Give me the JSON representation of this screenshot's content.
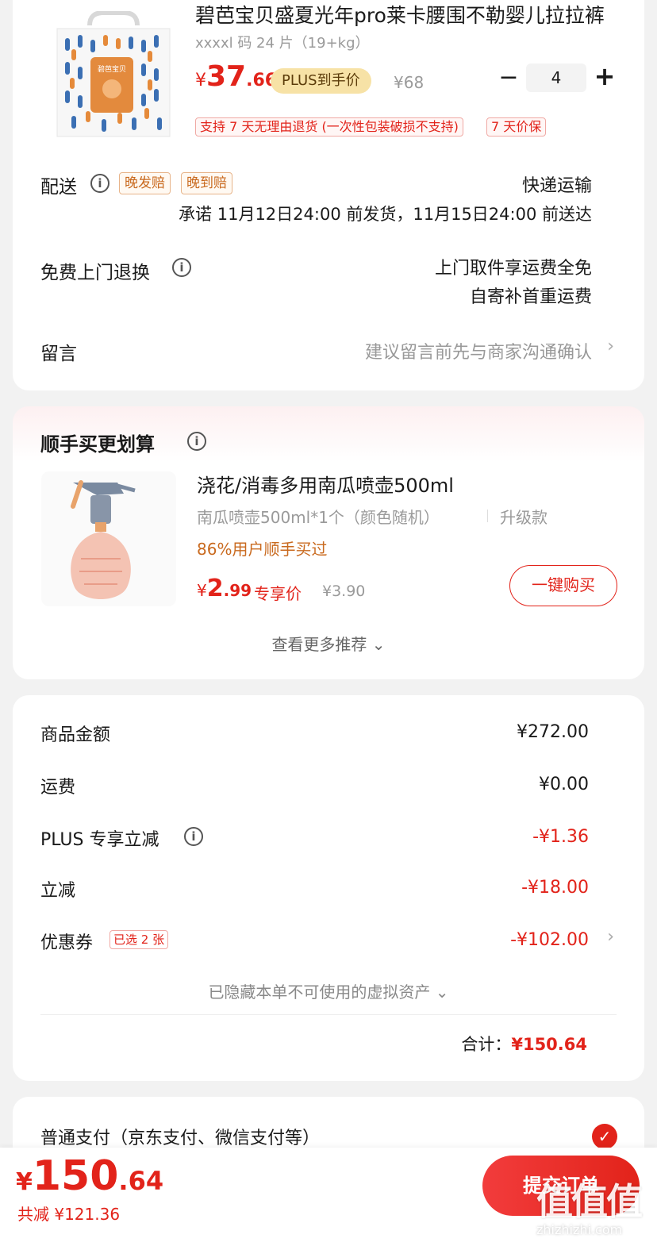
{
  "product": {
    "title": "碧芭宝贝盛夏光年pro莱卡腰围不勒婴儿拉拉裤",
    "spec": "xxxxl 码 24 片（19+kg）",
    "price_symbol": "¥",
    "price_int": "37",
    "price_dec": ".66",
    "plus_tag": "PLUS到手价",
    "orig_price": "¥68",
    "qty_minus": "−",
    "quantity": "4",
    "qty_plus": "+",
    "tag_return": "支持 7 天无理由退货 (一次性包装破损不支持)",
    "tag_price_protect": "7 天价保",
    "brand_badge": "碧芭宝贝"
  },
  "delivery": {
    "label": "配送",
    "tag_late_ship": "晚发赔",
    "tag_late_arrive": "晚到赔",
    "method": "快递运输",
    "promise": "承诺 11月12日24:00 前发货，11月15日24:00 前送达"
  },
  "returns": {
    "label": "免费上门退换",
    "line1": "上门取件享运费全免",
    "line2": "自寄补首重运费"
  },
  "message": {
    "label": "留言",
    "placeholder": "建议留言前先与商家沟通确认"
  },
  "recommend": {
    "title": "顺手买更划算",
    "item_name": "浇花/消毒多用南瓜喷壶500ml",
    "item_spec": "南瓜喷壶500ml*1个（颜色随机）",
    "item_spec2": "升级款",
    "buyers": "86%用户顺手买过",
    "price_symbol": "¥",
    "price_int": "2",
    "price_dec": ".99",
    "exclusive_label": "专享价",
    "orig_price": "¥3.90",
    "buy_button": "一键购买",
    "more": "查看更多推荐 ⌄"
  },
  "summary": {
    "goods_label": "商品金额",
    "goods_value": "¥272.00",
    "shipping_label": "运费",
    "shipping_value": "¥0.00",
    "plus_label": "PLUS 专享立减",
    "plus_value": "-¥1.36",
    "discount_label": "立减",
    "discount_value": "-¥18.00",
    "coupon_label": "优惠券",
    "coupon_tag": "已选 2 张",
    "coupon_value": "-¥102.00",
    "hidden_assets": "已隐藏本单不可使用的虚拟资产 ⌄",
    "total_label": "合计：",
    "total_value": "¥150.64"
  },
  "payment": {
    "label": "普通支付（京东支付、微信支付等）"
  },
  "bottom": {
    "price_symbol": "¥",
    "price_int": "150",
    "price_dec": ".64",
    "saved": "共减 ¥121.36",
    "submit": "提交订单"
  },
  "watermark": {
    "text": "值值值",
    "url": "zhizhizhi.com"
  },
  "colors": {
    "accent": "#e2231a",
    "orange": "#c96a1f",
    "gold_tag": "#f7e2a6"
  }
}
